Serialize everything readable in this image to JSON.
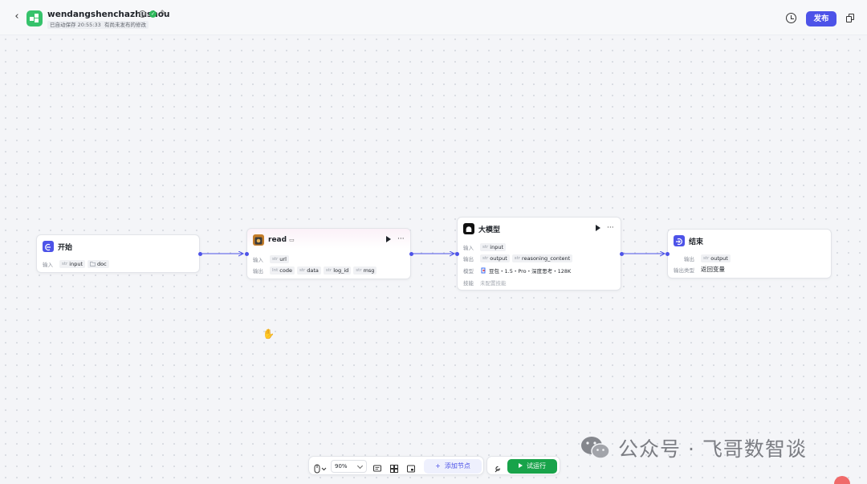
{
  "header": {
    "app_name": "wendangshenchazhushou",
    "autosave": "已自动保存 20:55:33",
    "unpublished": "有尚未发布的修改",
    "publish_label": "发布"
  },
  "nodes": {
    "start": {
      "title": "开始",
      "input_label": "输入",
      "inputs": [
        {
          "type": "str",
          "name": "input"
        },
        {
          "type": "",
          "name": "doc"
        }
      ]
    },
    "read": {
      "title": "read",
      "input_label": "输入",
      "inputs": [
        {
          "type": "str",
          "name": "url"
        }
      ],
      "output_label": "输出",
      "outputs": [
        {
          "type": "Int",
          "name": "code"
        },
        {
          "type": "str",
          "name": "data"
        },
        {
          "type": "str",
          "name": "log_id"
        },
        {
          "type": "str",
          "name": "msg"
        }
      ]
    },
    "llm": {
      "title": "大模型",
      "input_label": "输入",
      "inputs": [
        {
          "type": "str",
          "name": "input"
        }
      ],
      "output_label": "输出",
      "outputs": [
        {
          "type": "str",
          "name": "output"
        },
        {
          "type": "str",
          "name": "reasoning_content"
        }
      ],
      "model_label": "模型",
      "model_value": "豆包・1.5・Pro・深度思考・128K",
      "skill_label": "技能",
      "skill_value": "未配置技能"
    },
    "end": {
      "title": "结束",
      "output_label": "输出",
      "outputs": [
        {
          "type": "str",
          "name": "output"
        }
      ],
      "output_type_label": "输出类型",
      "output_type_value": "返回变量"
    }
  },
  "toolbar": {
    "zoom": "90%",
    "add_node_label": "添加节点",
    "run_label": "试运行"
  },
  "watermark": {
    "text": "公众号 · 飞哥数智谈"
  },
  "colors": {
    "accent": "#4d53e8",
    "run_green": "#18a34a",
    "start_icon": "#4d53e8",
    "app_icon": "#35c26b"
  }
}
